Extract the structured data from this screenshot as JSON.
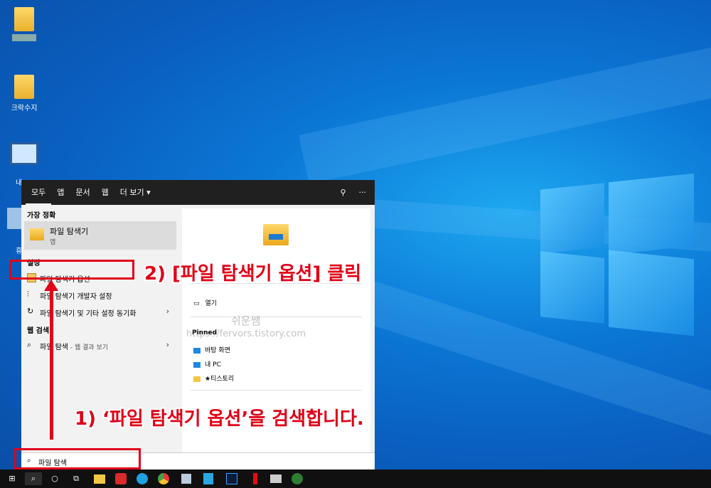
{
  "desktop": {
    "icons": [
      {
        "label": ""
      },
      {
        "label": "크락수지"
      },
      {
        "label": "내"
      },
      {
        "label": "휴"
      }
    ]
  },
  "start_menu": {
    "tabs": [
      "모두",
      "앱",
      "문서",
      "웹",
      "더 보기 ▾"
    ],
    "top_right": {
      "feedback": "⚲",
      "more": "···"
    },
    "best_match_header": "가장 정확",
    "best_match": {
      "title": "파일 탐색기",
      "subtitle": "앱"
    },
    "settings_header": "설정",
    "settings_items": [
      {
        "label": "파일 탐색기 옵션",
        "arrow": ""
      },
      {
        "label": "파일 탐색기 개발자 설정",
        "arrow": ""
      },
      {
        "label": "파일 탐색기 및 기타 설정 동기화",
        "arrow": "›"
      }
    ],
    "web_header": "웹 검색",
    "web_item": {
      "label": "파일 탐색",
      "suffix": " - 웹 결과 보기",
      "arrow": "›"
    },
    "preview": {
      "open_label": "열기",
      "pinned_header": "Pinned",
      "pinned": [
        {
          "label": "바탕 화면",
          "color": "#1e88e5"
        },
        {
          "label": "내 PC",
          "color": "#1e88e5"
        },
        {
          "label": "★티스토리",
          "color": "#f2c744"
        }
      ]
    }
  },
  "search": {
    "value": "파일 탐색",
    "icon": "⌕"
  },
  "taskbar": {
    "start": "⊞",
    "search": "⌕",
    "cortana": "○",
    "taskview": "⧉"
  },
  "annotations": {
    "step2": "2) [파일 탐색기 옵션] 클릭",
    "step1": "1) ‘파일 탐색기 옵션’을 검색합니다."
  },
  "watermark": {
    "line1": "쉬운쌤",
    "line2": "https://fervors.tistory.com"
  },
  "colors": {
    "accent_red": "#e00017",
    "desktop_blue": "#0b78d6"
  }
}
